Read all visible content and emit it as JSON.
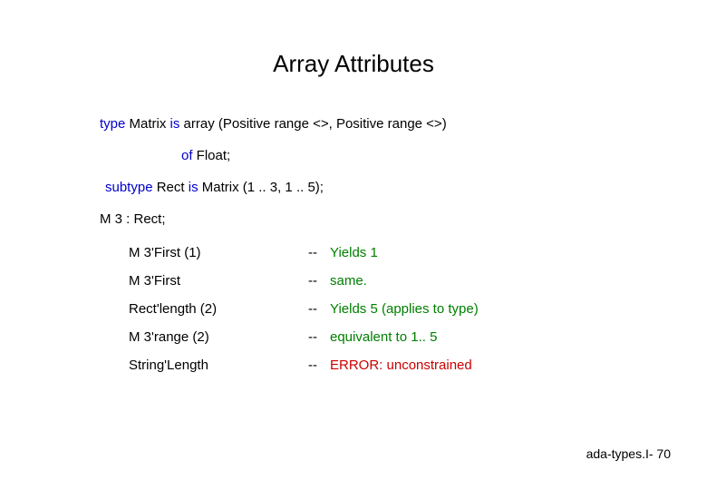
{
  "title": "Array Attributes",
  "code": {
    "kw_type": "type",
    "l1_after_type": " Matrix ",
    "kw_is1": "is",
    "l1_after_is": " array (Positive range <>, Positive range <>)",
    "kw_of": "of",
    "l2_after_of": " Float;",
    "kw_subtype": "subtype",
    "l3_after_subtype": " Rect ",
    "kw_is2": "is",
    "l3_after_is": " Matrix (1 .. 3, 1 .. 5);",
    "l4": "M 3 : Rect;"
  },
  "rows": [
    {
      "attr": "M 3'First (1)",
      "dash": "--",
      "comment": "Yields 1",
      "err": false
    },
    {
      "attr": "M 3'First",
      "dash": "--",
      "comment": "same.",
      "err": false
    },
    {
      "attr": "Rect'length (2)",
      "dash": "--",
      "comment": "Yields 5 (applies to type)",
      "err": false
    },
    {
      "attr": "M 3'range (2)",
      "dash": "--",
      "comment": "equivalent to 1.. 5",
      "err": false
    },
    {
      "attr": "String'Length",
      "dash": "--",
      "comment": "ERROR: unconstrained",
      "err": true
    }
  ],
  "footer": "ada-types.I- 70"
}
